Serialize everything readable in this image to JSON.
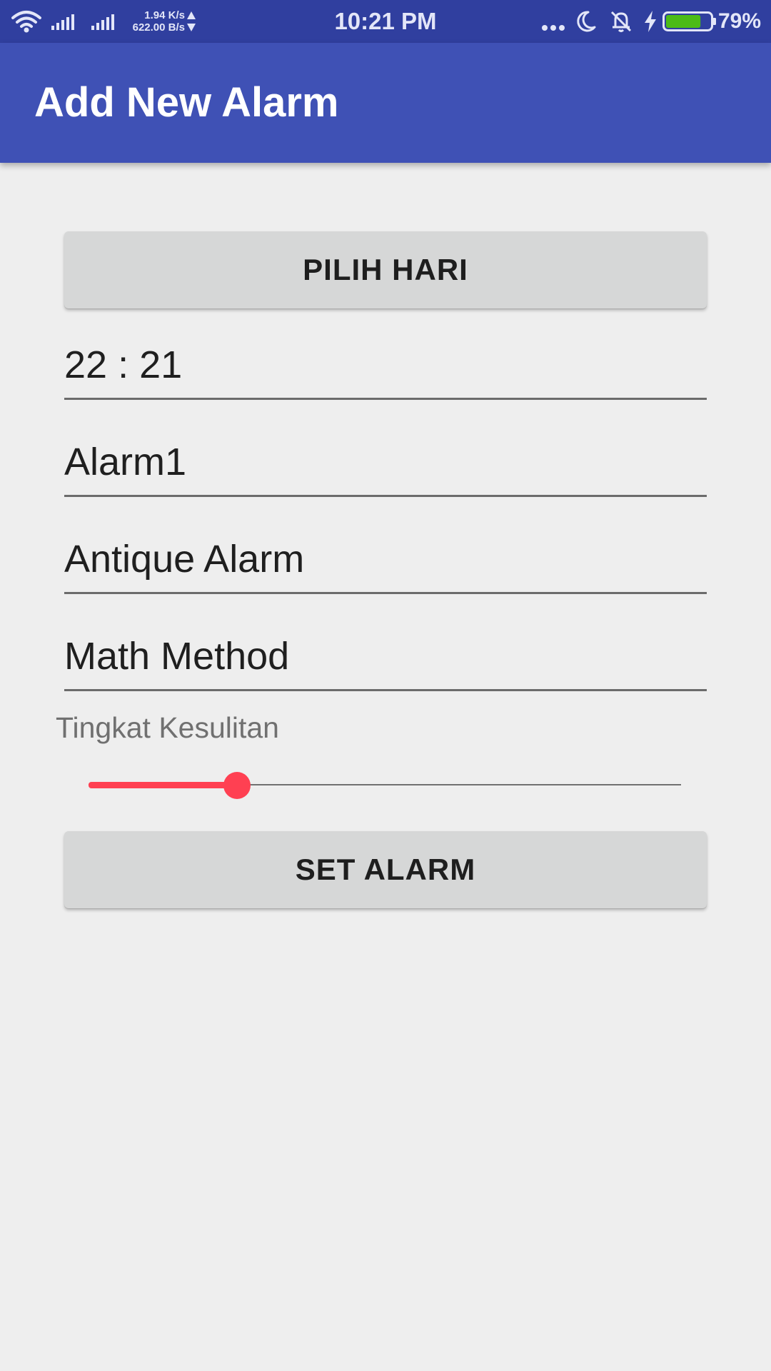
{
  "status_bar": {
    "net_up": "1.94 K/s",
    "net_down": "622.00 B/s",
    "time": "10:21 PM",
    "battery_percent": "79%",
    "battery_level": 0.79,
    "icons": [
      "wifi-icon",
      "signal-icon",
      "signal-icon",
      "more-dots-icon",
      "moon-icon",
      "bell-off-icon",
      "charging-icon",
      "battery-icon"
    ],
    "battery_color": "#4cbb17"
  },
  "app_bar": {
    "title": "Add New Alarm",
    "color": "#3f51b5",
    "status_color": "#303f9f"
  },
  "form": {
    "day_button": "PILIH HARI",
    "time_value": "22 : 21",
    "name_value": "Alarm1",
    "ringtone_value": "Antique Alarm",
    "method_value": "Math Method",
    "difficulty_label": "Tingkat Kesulitan",
    "difficulty_fraction": 0.25,
    "accent_color": "#ff4052",
    "set_button": "SET ALARM"
  }
}
